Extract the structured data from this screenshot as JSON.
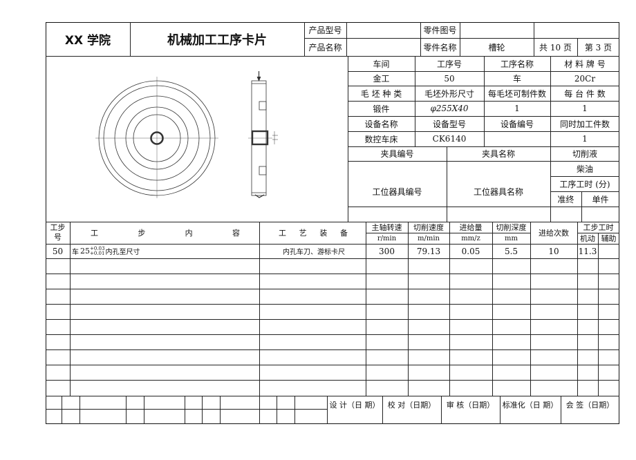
{
  "header": {
    "school": "XX 学院",
    "title": "机械加工工序卡片",
    "product_model_label": "产品型号",
    "product_name_label": "产品名称",
    "part_drawing_label": "零件图号",
    "part_name_label": "零件名称",
    "part_name_value": "槽轮",
    "total_pages": "共 10 页",
    "page_no": "第 3 页"
  },
  "info": {
    "workshop_label": "车间",
    "op_no_label": "工序号",
    "op_name_label": "工序名称",
    "material_label": "材 料 牌 号",
    "workshop": "金工",
    "op_no": "50",
    "op_name": "车",
    "material": "20Cr",
    "blank_type_label": "毛 坯 种 类",
    "blank_size_label": "毛坯外形尺寸",
    "per_blank_label": "每毛坯可制件数",
    "per_unit_label": "每 台 件 数",
    "blank_type": "锻件",
    "blank_size": "φ255X40",
    "per_blank": "1",
    "per_unit": "1",
    "equip_name_label": "设备名称",
    "equip_model_label": "设备型号",
    "equip_no_label": "设备编号",
    "simul_label": "同时加工件数",
    "equip_name": "数控车床",
    "equip_model": "CK6140",
    "equip_no": "",
    "simul": "1",
    "fixture_no_label": "夹具编号",
    "fixture_name_label": "夹具名称",
    "coolant_label": "切削液",
    "coolant": "柴油",
    "tool_no_label": "工位器具编号",
    "tool_name_label": "工位器具名称",
    "op_time_label": "工序工时 (分)",
    "prep_label": "准终",
    "unit_label": "单件"
  },
  "steps_header": {
    "step_no": "工步号",
    "content": [
      "工",
      "步",
      "内",
      "容"
    ],
    "equipment": [
      "工",
      "艺",
      "装",
      "备"
    ],
    "spindle": "主轴转速",
    "spindle_unit": "r/min",
    "speed": "切削速度",
    "speed_unit": "m/min",
    "feed": "进给量",
    "feed_unit": "mm/z",
    "depth": "切削深度",
    "depth_unit": "mm",
    "passes": "进给次数",
    "step_time": "工步工时",
    "machine": "机动",
    "aux": "辅助"
  },
  "steps": [
    {
      "no": "50",
      "content_prefix": "车",
      "content_base": "25",
      "tol_upper": "+0.03",
      "tol_lower": "+0.01",
      "content_suffix": "内孔至尺寸",
      "equipment": "内孔车刀、游标卡尺",
      "spindle": "300",
      "speed": "79.13",
      "feed": "0.05",
      "depth": "5.5",
      "passes": "10",
      "machine": "11.3",
      "aux": ""
    }
  ],
  "footer": {
    "design": "设 计（日 期）",
    "check": "校 对（日期）",
    "review": "审 核（日期）",
    "standard": "标准化（日 期）",
    "sign": "会 签（日期）"
  }
}
